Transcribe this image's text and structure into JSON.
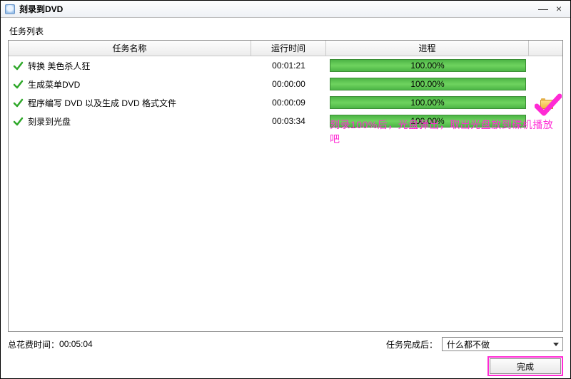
{
  "window": {
    "title": "刻录到DVD"
  },
  "section_label": "任务列表",
  "columns": {
    "name": "任务名称",
    "time": "运行时间",
    "progress": "进程"
  },
  "tasks": [
    {
      "name": "转换 美色杀人狂",
      "time": "00:01:21",
      "progress": "100.00%",
      "extra": ""
    },
    {
      "name": "生成菜单DVD",
      "time": "00:00:00",
      "progress": "100.00%",
      "extra": ""
    },
    {
      "name": "程序编写 DVD 以及生成 DVD 格式文件",
      "time": "00:00:09",
      "progress": "100.00%",
      "extra": "folder"
    },
    {
      "name": "刻录到光盘",
      "time": "00:03:34",
      "progress": "100.00%",
      "extra": ""
    }
  ],
  "annotation_text": "刻录100%后，光盘弹出，取出光盘放到碟机播放吧",
  "footer": {
    "total_label": "总花费时间：",
    "total_value": "00:05:04",
    "after_label": "任务完成后：",
    "after_value": "什么都不做",
    "done": "完成"
  }
}
